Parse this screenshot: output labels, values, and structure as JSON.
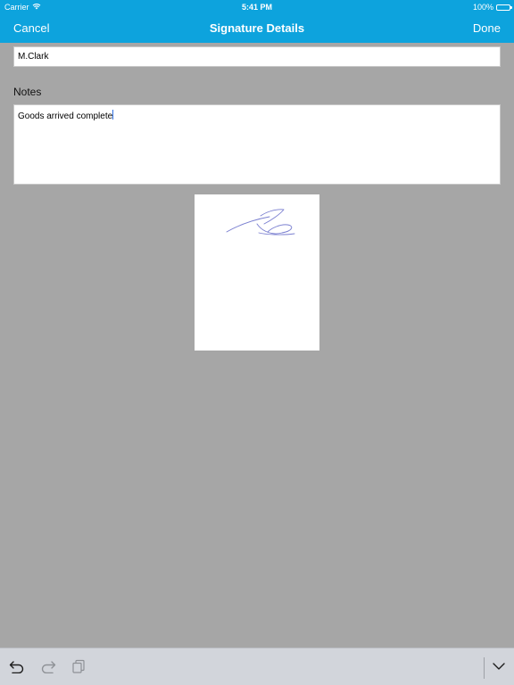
{
  "status_bar": {
    "carrier": "Carrier",
    "time": "5:41 PM",
    "battery": "100%"
  },
  "nav": {
    "cancel_label": "Cancel",
    "title": "Signature Details",
    "done_label": "Done"
  },
  "form": {
    "name_value": "M.Clark",
    "notes_label": "Notes",
    "notes_value": "Goods arrived complete"
  },
  "keyboard_toolbar": {
    "undo_icon": "undo-icon",
    "redo_icon": "redo-icon",
    "paste_icon": "paste-icon",
    "dismiss_icon": "chevron-down-icon"
  },
  "colors": {
    "accent": "#0da3dd",
    "background": "#a6a6a6",
    "signature_ink": "#7a7fd0",
    "keyboard_bar": "#d2d5db"
  }
}
